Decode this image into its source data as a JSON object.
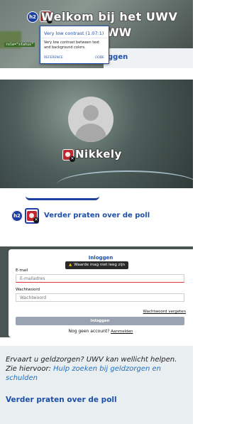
{
  "colors": {
    "accent": "#1d4fa8",
    "badge_blue": "#1f3fa0",
    "error_red": "#c0262d",
    "warning_yellow": "#f5c400"
  },
  "panel1": {
    "role_code": "role=\"status\"",
    "heading_line1": "Welkom bij het UWV",
    "heading_line2": "WW",
    "link_fragment": "ggen",
    "badge_h2": "h2",
    "tooltip": {
      "title": "Very low contrast (1.07:1)",
      "body": "Very low contrast between text and background colors.",
      "reference": "REFERENCE",
      "code": "CODE"
    }
  },
  "panel2": {
    "nickname": "Nikkely"
  },
  "panel3": {
    "badge_h2": "h2",
    "poll_link": "Verder praten over de poll"
  },
  "panel4": {
    "title": "Inloggen",
    "warning": "Waarde mag niet leeg zijn",
    "email_label": "E-mail",
    "email_placeholder": "E-mailadres",
    "password_label": "Wachtwoord",
    "password_placeholder": "Wachtwoord",
    "forgot": "Wachtwoord vergeten",
    "login_button": "Inloggen",
    "no_account": "Nog geen account?",
    "register": "Aanmelden"
  },
  "panel5": {
    "para_text": "Ervaart u geldzorgen?  UWV kan wellicht helpen. Zie hiervoor: ",
    "para_link": "Hulp zoeken bij geldzorgen en schulden",
    "poll_link": "Verder praten over de poll"
  }
}
